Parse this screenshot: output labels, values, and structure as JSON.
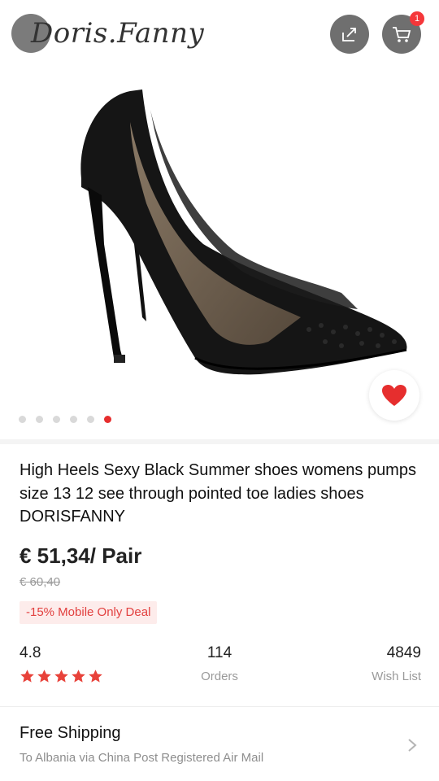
{
  "header": {
    "logo_text": "Doris.Fanny",
    "cart_count": "1",
    "share_icon": "share-icon",
    "cart_icon": "cart-icon"
  },
  "gallery": {
    "image_count": 6,
    "active_index": 5,
    "favorite_icon": "heart-icon"
  },
  "product": {
    "title": "High Heels Sexy Black Summer shoes womens pumps size 13 12 see through pointed toe ladies shoes DORISFANNY",
    "price": "€ 51,34/ Pair",
    "original_price": "€ 60,40",
    "deal_label": "-15% Mobile Only Deal"
  },
  "stats": {
    "rating": "4.8",
    "rating_stars": 5,
    "orders_count": "114",
    "orders_label": "Orders",
    "wishlist_count": "4849",
    "wishlist_label": "Wish List"
  },
  "shipping": {
    "title": "Free Shipping",
    "subtitle": "To Albania via China Post Registered Air Mail"
  },
  "colors": {
    "accent": "#e62e2e",
    "badge_bg": "#fdeceb",
    "badge_text": "#e2403f",
    "muted": "#9a9a9a"
  }
}
